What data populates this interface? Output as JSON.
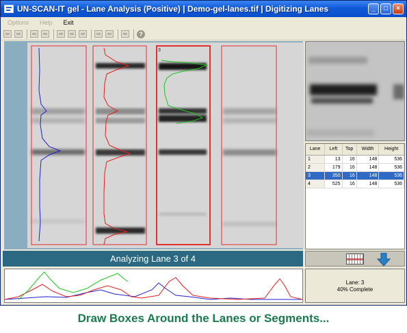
{
  "window": {
    "title": "UN-SCAN-IT gel - Lane Analysis (Positive) | Demo-gel-lanes.tif | Digitizing Lanes",
    "minimize_glyph": "_",
    "maximize_glyph": "□",
    "close_glyph": "×"
  },
  "menu": [
    "Options",
    "Help",
    "Exit"
  ],
  "toolbar": {
    "help_glyph": "?"
  },
  "lanes_table": {
    "headers": [
      "Lane",
      "Left",
      "Top",
      "Width",
      "Height"
    ],
    "rows": [
      [
        "1",
        "13",
        "16",
        "148",
        "536"
      ],
      [
        "2",
        "179",
        "16",
        "148",
        "536"
      ],
      [
        "3",
        "350",
        "16",
        "148",
        "536"
      ],
      [
        "4",
        "525",
        "16",
        "148",
        "536"
      ]
    ],
    "selected_row": 3
  },
  "gel": {
    "active_lane_label": "3"
  },
  "status": {
    "analyzing": "Analyzing Lane 3 of 4",
    "lane_line": "Lane: 3",
    "complete_line": "40% Complete",
    "progress_percent": 40
  },
  "caption": "Draw Boxes Around the Lanes or Segments...",
  "colors": {
    "title_bar": "#0f5ad8",
    "status_bar": "#2b6982",
    "lane_box": "#e03030",
    "trace_lane1": "#2020d0",
    "trace_lane2": "#e02020",
    "trace_lane3": "#20c020",
    "caption": "#1a7a4e"
  }
}
